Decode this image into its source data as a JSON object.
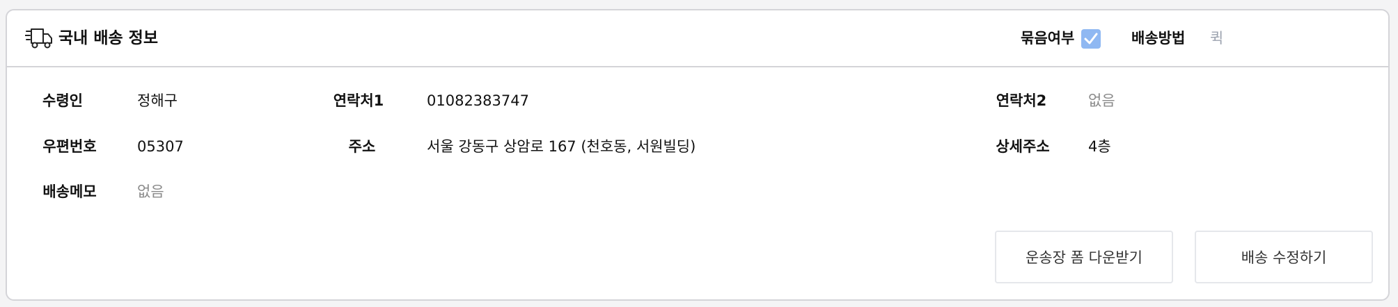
{
  "header": {
    "title": "국내 배송 정보",
    "bundle_label": "묶음여부",
    "bundle_checked": true,
    "shipping_method_label": "배송방법",
    "shipping_method_value": "퀵"
  },
  "fields": {
    "recipient": {
      "label": "수령인",
      "value": "정해구"
    },
    "contact1": {
      "label": "연락처1",
      "value": "01082383747"
    },
    "contact2": {
      "label": "연락처2",
      "value": "없음"
    },
    "postal_code": {
      "label": "우편번호",
      "value": "05307"
    },
    "address": {
      "label": "주소",
      "value": "서울 강동구 상암로 167 (천호동, 서원빌딩)"
    },
    "detail_address": {
      "label": "상세주소",
      "value": "4층"
    },
    "delivery_memo": {
      "label": "배송메모",
      "value": "없음"
    }
  },
  "buttons": {
    "download_waybill": "운송장 폼 다운받기",
    "edit_delivery": "배송 수정하기"
  },
  "colors": {
    "checkbox": "#8fb8f2",
    "border": "#d4d4d8",
    "muted_text": "#8a8a8a"
  }
}
